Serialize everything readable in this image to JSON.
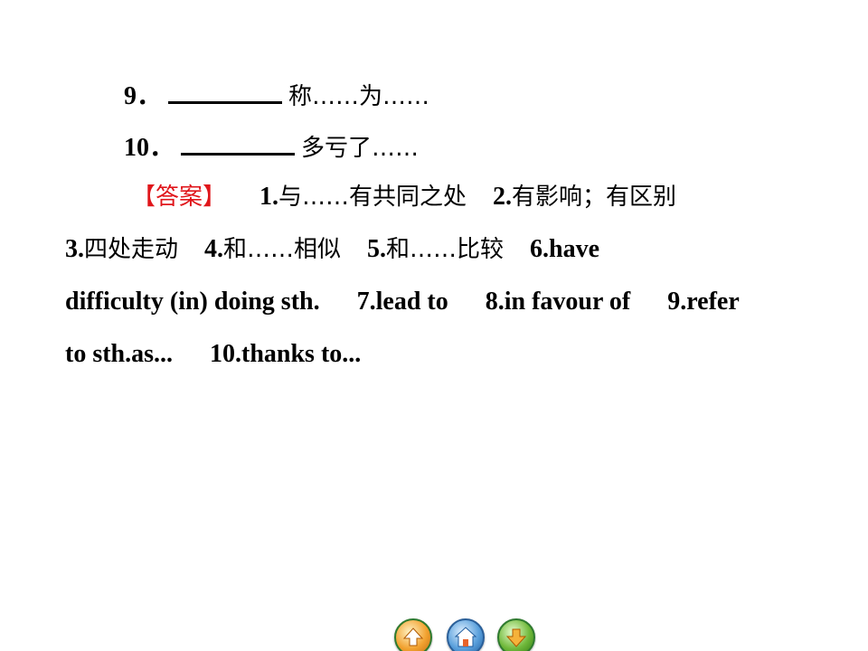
{
  "questions": [
    {
      "number": "9．",
      "meaning": "称……为……"
    },
    {
      "number": "10．",
      "meaning": "多亏了……"
    }
  ],
  "answer_label": "【答案】",
  "answers": {
    "a1_num": "1.",
    "a1_text": "与……有共同之处",
    "a2_num": "2.",
    "a2_text": "有影响；有区别",
    "a3_num": "3.",
    "a3_text": "四处走动",
    "a4_num": "4.",
    "a4_text": "和……相似",
    "a5_num": "5.",
    "a5_text": "和……比较",
    "a6": "6.have",
    "a6_cont": "difficulty (in) doing sth.",
    "a7": "7.lead to",
    "a8": "8.in favour of",
    "a9": "9.refer",
    "a9_cont": "to sth.as...",
    "a10": "10.thanks to..."
  },
  "nav": {
    "colors": {
      "prev": "#f2a230",
      "home": "#3d86c9",
      "next": "#6fb83a",
      "ring": "#2e7a2e"
    },
    "icons": [
      "arrow-up-icon",
      "home-icon",
      "arrow-down-icon"
    ]
  }
}
